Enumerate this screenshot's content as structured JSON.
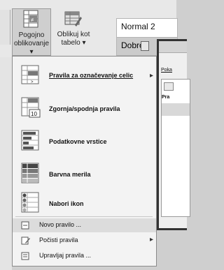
{
  "ribbon": {
    "conditional_formatting_label": "Pogojno oblikovanje",
    "format_as_table_label": "Oblikuj kot tabelo",
    "styles": {
      "normal": "Normal 2",
      "good": "Dobro"
    }
  },
  "dialog": {
    "show_label": "Poka",
    "column_header": "Pra"
  },
  "menu": {
    "items": [
      {
        "label": "Pravila za označevanje celic",
        "icon": "highlight-cells-icon"
      },
      {
        "label": "Zgornja/spodnja pravila",
        "icon": "top-bottom-rules-icon",
        "icon_text": "10"
      },
      {
        "label": "Podatkovne vrstice",
        "icon": "data-bars-icon"
      },
      {
        "label": "Barvna merila",
        "icon": "color-scales-icon"
      },
      {
        "label": "Nabori ikon",
        "icon": "icon-sets-icon"
      }
    ],
    "small_items": [
      {
        "label": "Novo pravilo ...",
        "icon": "new-rule-icon"
      },
      {
        "label": "Počisti pravila",
        "icon": "clear-rules-icon"
      },
      {
        "label": "Upravljaj pravila ...",
        "icon": "manage-rules-icon"
      }
    ]
  }
}
